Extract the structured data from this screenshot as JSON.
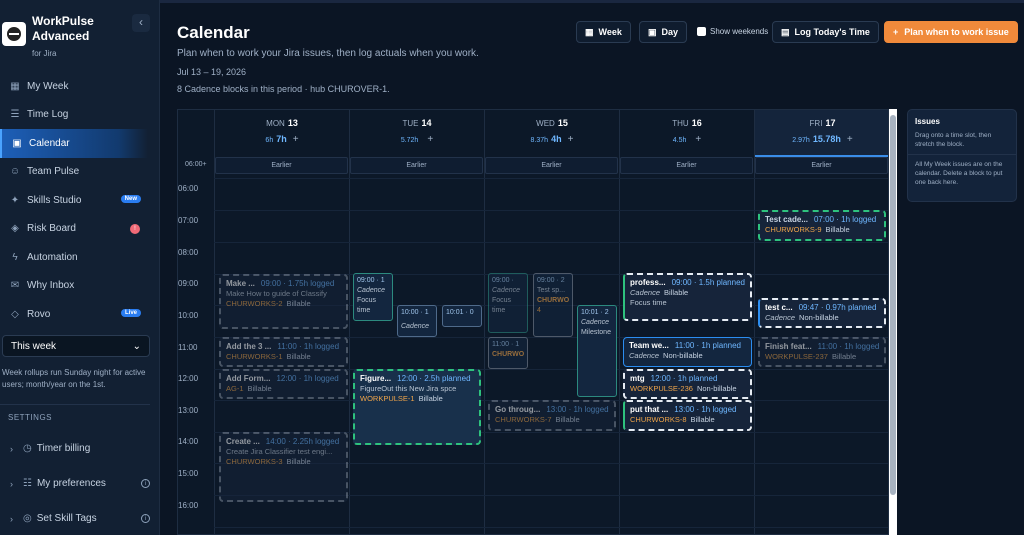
{
  "brand": {
    "name": "WorkPulse Advanced",
    "sub": "for Jira"
  },
  "nav": [
    {
      "label": "My Week",
      "icon": "grid-icon"
    },
    {
      "label": "Time Log",
      "icon": "list-icon"
    },
    {
      "label": "Calendar",
      "icon": "calendar-icon",
      "active": true
    },
    {
      "label": "Team Pulse",
      "icon": "people-icon"
    },
    {
      "label": "Skills Studio",
      "icon": "skills-icon",
      "badge": "New"
    },
    {
      "label": "Risk Board",
      "icon": "shield-icon",
      "badge": "!"
    },
    {
      "label": "Automation",
      "icon": "bolt-icon"
    },
    {
      "label": "Why Inbox",
      "icon": "inbox-icon"
    },
    {
      "label": "Rovo",
      "icon": "rovo-icon",
      "badge": "Live"
    }
  ],
  "period_select": "This week",
  "rollup_note": "Week rollups run Sunday night for active users; month/year on the 1st.",
  "settings": {
    "heading": "SETTINGS",
    "items": [
      "Timer billing",
      "My preferences",
      "Set Skill Tags"
    ]
  },
  "page": {
    "title": "Calendar",
    "subtitle": "Plan when to work your Jira issues, then log actuals when you work.",
    "range": "Jul 13 – 19, 2026",
    "summary": "8 Cadence blocks in this period · hub CHUROVER-1."
  },
  "toolbar": {
    "week": "Week",
    "day": "Day",
    "show_weekends": "Show weekends",
    "log_today": "Log Today's Time",
    "plan": "Plan when to work issue"
  },
  "days": [
    {
      "dow": "MON",
      "num": "13",
      "planned": "6h",
      "logged": "7h"
    },
    {
      "dow": "TUE",
      "num": "14",
      "planned": "5.72h",
      "logged": ""
    },
    {
      "dow": "WED",
      "num": "15",
      "planned": "8.37h",
      "logged": "4h"
    },
    {
      "dow": "THU",
      "num": "16",
      "planned": "4.5h",
      "logged": ""
    },
    {
      "dow": "FRI",
      "num": "17",
      "planned": "2.97h",
      "logged": "15.78h"
    }
  ],
  "earlier_label": "Earlier",
  "earlier_time": "06:00+",
  "hours": [
    "06:00",
    "07:00",
    "08:00",
    "09:00",
    "10:00",
    "11:00",
    "12:00",
    "13:00",
    "14:00",
    "15:00",
    "16:00"
  ],
  "events": {
    "mon1": {
      "title": "Make ...",
      "time": "09:00 · 1.75h logged",
      "sub": "Make How to guide of Classify",
      "key": "CHURWORKS-2",
      "tag": "Billable"
    },
    "mon2": {
      "title": "Add the 3 ...",
      "time": "11:00 · 1h logged",
      "key": "CHURWORKS-1",
      "tag": "Billable"
    },
    "mon3": {
      "title": "Add Form...",
      "time": "12:00 · 1h logged",
      "key": "AG-1",
      "tag": "Billable"
    },
    "mon4": {
      "title": "Create ...",
      "time": "14:00 · 2.25h logged",
      "sub": "Create Jira Classifier test engi...",
      "key": "CHURWORKS-3",
      "tag": "Billable"
    },
    "tue1": {
      "title": "Figure...",
      "time": "12:00 · 2.5h planned",
      "sub": "FigureOut this New Jira spce",
      "key": "WORKPULSE-1",
      "tag": "Billable"
    },
    "wed1": {
      "title": "Go throug...",
      "time": "13:00 · 1h logged",
      "key": "CHURWORKS-7",
      "tag": "Billable"
    },
    "thu1": {
      "title": "profess...",
      "time": "09:00 · 1.5h planned",
      "cadence": "Cadence",
      "tag": "Billable",
      "sub": "Focus time"
    },
    "thu2": {
      "title": "Team we...",
      "time": "11:00 · 1h planned",
      "cadence": "Cadence",
      "tag": "Non-billable"
    },
    "thu3": {
      "title": "mtg",
      "time": "12:00 · 1h planned",
      "key": "WORKPULSE-236",
      "tag": "Non-billable"
    },
    "thu4": {
      "title": "put that ...",
      "time": "13:00 · 1h logged",
      "key": "CHURWORKS-8",
      "tag": "Billable"
    },
    "fri1": {
      "title": "Test cade...",
      "time": "07:00 · 1h logged",
      "key": "CHURWORKS-9",
      "tag": "Billable"
    },
    "fri2": {
      "title": "test c...",
      "time": "09:47 · 0.97h planned",
      "cadence": "Cadence",
      "tag": "Non-billable"
    },
    "fri3": {
      "title": "Finish feat...",
      "time": "11:00 · 1h logged",
      "key": "WORKPULSE-237",
      "tag": "Billable"
    }
  },
  "minis": {
    "tue_a": {
      "time": "09:00 · 1",
      "l1": "Cadence",
      "l2": "Focus",
      "l3": "time"
    },
    "tue_b": {
      "time": "10:00 · 1",
      "l1": "Cadence"
    },
    "tue_c": {
      "time": "10:01 · 0"
    },
    "wed_a": {
      "time": "09:00 ·",
      "l1": "Cadence",
      "l2": "Focus",
      "l3": "time"
    },
    "wed_b": {
      "time": "09:00 · 2",
      "l1": "Test sp...",
      "l2": "CHURWO",
      "l3": "4"
    },
    "wed_c": {
      "time": "10:01 · 2",
      "l1": "Cadence",
      "l2": "Milestone"
    },
    "wed_d": {
      "time": "11:00 · 1",
      "l1": "CHURWO"
    }
  },
  "issues_panel": {
    "title": "Issues",
    "p1": "Drag onto a time slot, then stretch the block.",
    "p2": "All My Week issues are on the calendar. Delete a block to put one back here."
  }
}
